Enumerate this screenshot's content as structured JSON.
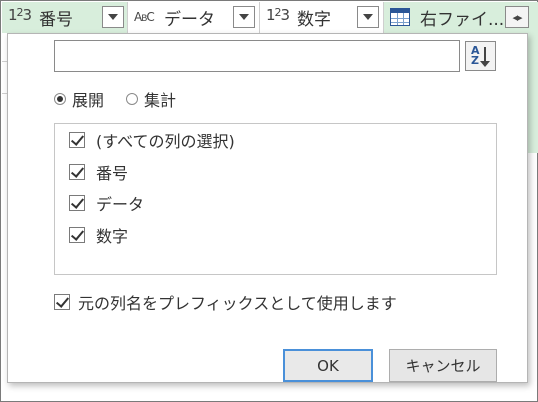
{
  "columns": [
    {
      "type_icon": "123",
      "label": "番号",
      "highlight": true
    },
    {
      "type_icon": "ABC",
      "label": "データ",
      "highlight": false
    },
    {
      "type_icon": "123",
      "label": "数字",
      "highlight": false
    },
    {
      "type_icon": "table-icon",
      "label": "右ファイ...",
      "highlight": true
    }
  ],
  "expand_icon": "expand-columns-icon",
  "dialog": {
    "search": {
      "value": "",
      "placeholder": ""
    },
    "sort_icon": "sort-az-icon",
    "radio": {
      "options": [
        {
          "label": "展開",
          "checked": true
        },
        {
          "label": "集計",
          "checked": false
        }
      ]
    },
    "list": [
      {
        "label": "(すべての列の選択)",
        "checked": true
      },
      {
        "label": "番号",
        "checked": true
      },
      {
        "label": "データ",
        "checked": true
      },
      {
        "label": "数字",
        "checked": true
      }
    ],
    "prefix": {
      "label": "元の列名をプレフィックスとして使用します",
      "checked": true
    },
    "ok_label": "OK",
    "cancel_label": "キャンセル"
  },
  "colors": {
    "accent": "#4a90d9",
    "column_highlight": "#d8eedc"
  }
}
